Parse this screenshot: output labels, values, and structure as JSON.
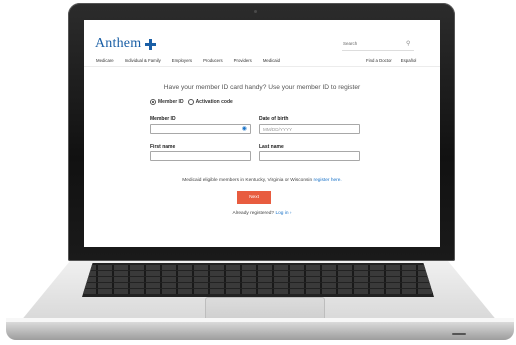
{
  "site": {
    "logo_text": "Anthem",
    "search_placeholder": "Search",
    "nav": [
      "Medicare",
      "Individual & Family",
      "Employers",
      "Producers",
      "Providers",
      "Medicaid"
    ],
    "nav_right": [
      "Find a Doctor",
      "Español"
    ]
  },
  "form": {
    "prompt": "Have your member ID card handy? Use your member ID to register",
    "radio_member_id": "Member ID",
    "radio_activation": "Activation code",
    "member_id_label": "Member ID",
    "dob_label": "Date of birth",
    "dob_placeholder": "MM/DD/YYYY",
    "first_name_label": "First name",
    "last_name_label": "Last name",
    "medicaid_note": "Medicaid eligible members in Kentucky, Virginia or Wisconsin",
    "register_link": "register here.",
    "next_button": "Next",
    "already_text": "Already registered?",
    "login_link": "Log in"
  },
  "colors": {
    "brand_blue": "#1a5fa6",
    "link_blue": "#1a73c8",
    "next_button": "#e85c3f"
  },
  "icons": {
    "logo": "cross-shield-icon",
    "search": "magnifier-icon",
    "eye": "eye-icon",
    "chevron": "chevron-right-icon"
  }
}
